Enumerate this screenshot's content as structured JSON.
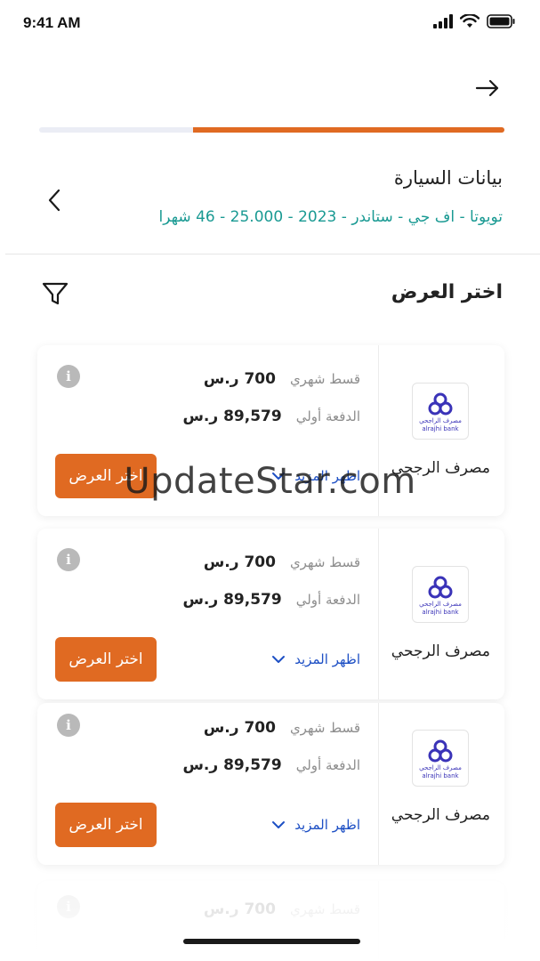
{
  "status_bar": {
    "time": "9:41 AM",
    "icons": [
      "signal-icon",
      "wifi-icon",
      "battery-icon"
    ]
  },
  "header": {
    "back_icon": "arrow-right-icon",
    "progress_fraction": 0.67
  },
  "car": {
    "title": "بيانات السيارة",
    "details": "تويوتا - اف جي - ستاندر - 2023 - 25.000 - 46 شهرا",
    "chevron_icon": "chevron-left-icon"
  },
  "offers": {
    "title": "اختر العرض",
    "filter_icon": "filter-icon",
    "cards": [
      {
        "bank_name": "مصرف الرجحي",
        "logo_text_ar": "مصرف الراجحي",
        "logo_text_en": "alrajhi bank",
        "monthly_label": "قسط شهري",
        "monthly_value": "700 ر.س",
        "down_label": "الدفعة أولي",
        "down_value": "89,579 ر.س",
        "show_more": "اظهر المزيد",
        "select_label": "اختر العرض"
      },
      {
        "bank_name": "مصرف الرجحي",
        "logo_text_ar": "مصرف الراجحي",
        "logo_text_en": "alrajhi bank",
        "monthly_label": "قسط شهري",
        "monthly_value": "700 ر.س",
        "down_label": "الدفعة أولي",
        "down_value": "89,579 ر.س",
        "show_more": "اظهر المزيد",
        "select_label": "اختر العرض"
      },
      {
        "bank_name": "مصرف الرجحي",
        "logo_text_ar": "مصرف الراجحي",
        "logo_text_en": "alrajhi bank",
        "monthly_label": "قسط شهري",
        "monthly_value": "700 ر.س",
        "down_label": "الدفعة أولي",
        "down_value": "89,579 ر.س",
        "show_more": "اظهر المزيد",
        "select_label": "اختر العرض"
      },
      {
        "monthly_label": "قسط شهري",
        "monthly_value": "700 ر.س"
      }
    ]
  },
  "watermark": "UpdateStar.com",
  "colors": {
    "accent": "#e06a22",
    "teal": "#1a9a93",
    "link": "#1d4fc4",
    "bank_logo": "#3a33b8"
  }
}
